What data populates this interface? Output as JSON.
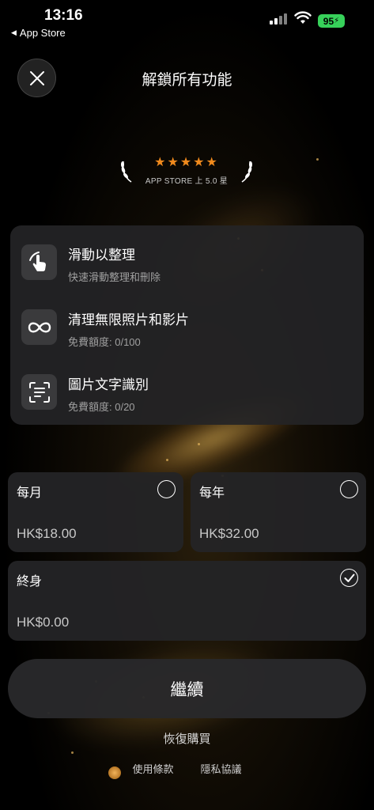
{
  "status_bar": {
    "time": "13:16",
    "back_app": "App Store",
    "battery": "95"
  },
  "header": {
    "title": "解鎖所有功能"
  },
  "rating": {
    "stars": "★★★★★",
    "text": "APP STORE 上 5.0 星"
  },
  "features": [
    {
      "title": "滑動以整理",
      "subtitle": "快速滑動整理和刪除",
      "icon": "swipe-hand-icon"
    },
    {
      "title": "清理無限照片和影片",
      "subtitle": "免費額度: 0/100",
      "icon": "infinity-icon"
    },
    {
      "title": "圖片文字識別",
      "subtitle": "免費額度: 0/20",
      "icon": "text-scan-icon"
    }
  ],
  "plans": [
    {
      "name": "每月",
      "price": "HK$18.00",
      "selected": false
    },
    {
      "name": "每年",
      "price": "HK$32.00",
      "selected": false
    },
    {
      "name": "終身",
      "price": "HK$0.00",
      "selected": true
    }
  ],
  "actions": {
    "continue": "繼續",
    "restore": "恢復購買",
    "terms": "使用條款",
    "privacy": "隱私協議"
  },
  "colors": {
    "accent_star": "#f08a1d",
    "battery": "#37d15a",
    "card_bg": "#242426"
  }
}
